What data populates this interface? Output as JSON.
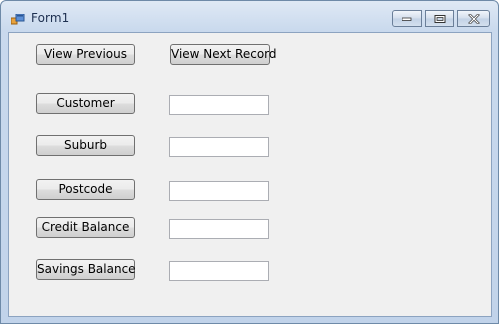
{
  "window": {
    "title": "Form1"
  },
  "buttons": {
    "view_previous": "View Previous",
    "view_next": "View Next Record",
    "customer": "Customer",
    "suburb": "Suburb",
    "postcode": "Postcode",
    "credit_balance": "Credit Balance",
    "savings_balance": "Savings Balance"
  },
  "fields": {
    "customer": "",
    "suburb": "",
    "postcode": "",
    "credit_balance": "",
    "savings_balance": ""
  },
  "icons": {
    "app": "windows-form-icon",
    "minimize": "minimize-icon",
    "maximize": "maximize-icon",
    "close": "close-icon"
  },
  "colors": {
    "title_bar": "#c9d9ed",
    "client_bg": "#f0f0f0",
    "button_border": "#707070"
  }
}
